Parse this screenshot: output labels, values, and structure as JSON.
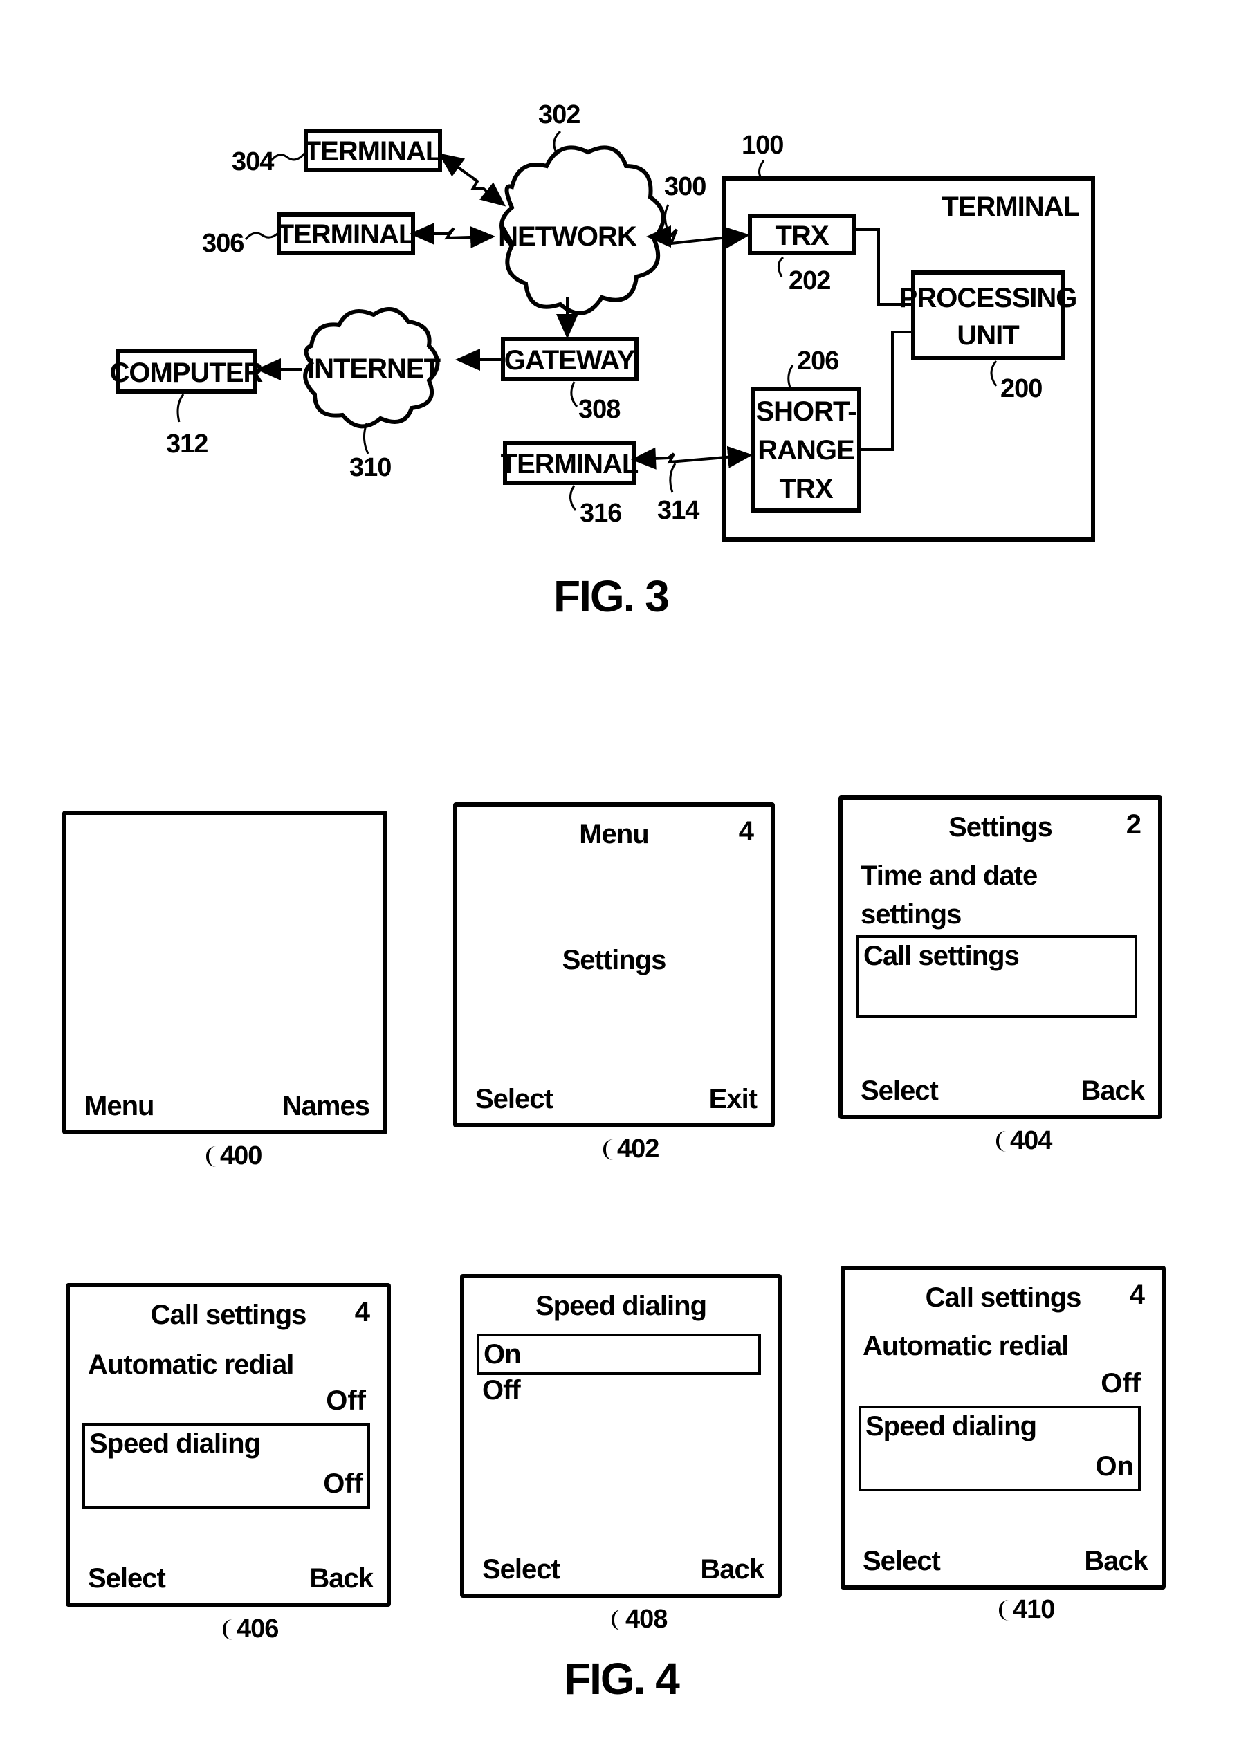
{
  "fig3": {
    "caption": "FIG. 3",
    "nodes": {
      "terminal_304": {
        "label": "TERMINAL",
        "ref": "304"
      },
      "terminal_306": {
        "label": "TERMINAL",
        "ref": "306"
      },
      "network": {
        "label": "NETWORK",
        "ref": "302"
      },
      "gateway": {
        "label": "GATEWAY",
        "ref": "308"
      },
      "internet": {
        "label": "INTERNET",
        "ref": "310"
      },
      "computer": {
        "label": "COMPUTER",
        "ref": "312"
      },
      "terminal_316": {
        "label": "TERMINAL",
        "ref": "316"
      },
      "terminal_100": {
        "label": "TERMINAL",
        "ref": "100"
      },
      "trx": {
        "label": "TRX",
        "ref": "202"
      },
      "processing_unit": {
        "label_line1": "PROCESSING",
        "label_line2": "UNIT",
        "ref": "200"
      },
      "short_range_trx": {
        "label_line1": "SHORT-",
        "label_line2": "RANGE",
        "label_line3": "TRX",
        "ref": "206"
      }
    },
    "links": {
      "wireless_link_300": "300",
      "short_range_link_314": "314"
    }
  },
  "fig4": {
    "caption": "FIG. 4",
    "screens": [
      {
        "ref": "400",
        "left_softkey": "Menu",
        "right_softkey": "Names"
      },
      {
        "ref": "402",
        "title": "Menu",
        "counter": "4",
        "center_item": "Settings",
        "left_softkey": "Select",
        "right_softkey": "Exit"
      },
      {
        "ref": "404",
        "title": "Settings",
        "counter": "2",
        "item1_line1": "Time and date",
        "item1_line2": "settings",
        "selected_item": "Call settings",
        "left_softkey": "Select",
        "right_softkey": "Back"
      },
      {
        "ref": "406",
        "title": "Call settings",
        "counter": "4",
        "item1": "Automatic redial",
        "item1_value": "Off",
        "selected_item": "Speed dialing",
        "selected_value": "Off",
        "left_softkey": "Select",
        "right_softkey": "Back"
      },
      {
        "ref": "408",
        "title": "Speed dialing",
        "selected_option": "On",
        "option2": "Off",
        "left_softkey": "Select",
        "right_softkey": "Back"
      },
      {
        "ref": "410",
        "title": "Call settings",
        "counter": "4",
        "item1": "Automatic redial",
        "item1_value": "Off",
        "selected_item": "Speed dialing",
        "selected_value": "On",
        "left_softkey": "Select",
        "right_softkey": "Back"
      }
    ]
  }
}
